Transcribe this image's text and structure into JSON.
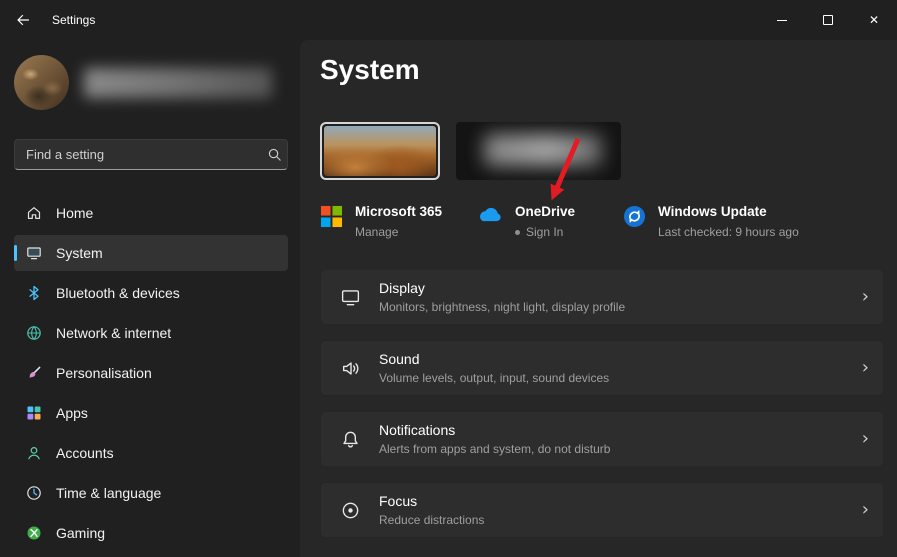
{
  "titlebar": {
    "title": "Settings",
    "controls": {
      "close": "✕"
    }
  },
  "sidebar": {
    "search": {
      "placeholder": "Find a setting"
    },
    "items": [
      {
        "label": "Home",
        "icon": "home-icon"
      },
      {
        "label": "System",
        "icon": "system-icon",
        "selected": true
      },
      {
        "label": "Bluetooth & devices",
        "icon": "bluetooth-icon"
      },
      {
        "label": "Network & internet",
        "icon": "network-icon"
      },
      {
        "label": "Personalisation",
        "icon": "personalisation-icon"
      },
      {
        "label": "Apps",
        "icon": "apps-icon"
      },
      {
        "label": "Accounts",
        "icon": "accounts-icon"
      },
      {
        "label": "Time & language",
        "icon": "time-language-icon"
      },
      {
        "label": "Gaming",
        "icon": "gaming-icon"
      }
    ]
  },
  "main": {
    "title": "System",
    "quick_cards": [
      {
        "title": "Microsoft 365",
        "subtitle": "Manage",
        "icon": "microsoft-365-icon"
      },
      {
        "title": "OneDrive",
        "subtitle": "Sign In",
        "icon": "onedrive-icon",
        "has_status_dot": true
      },
      {
        "title": "Windows Update",
        "subtitle": "Last checked: 9 hours ago",
        "icon": "windows-update-icon"
      }
    ],
    "rows": [
      {
        "title": "Display",
        "subtitle": "Monitors, brightness, night light, display profile",
        "icon": "display-icon"
      },
      {
        "title": "Sound",
        "subtitle": "Volume levels, output, input, sound devices",
        "icon": "sound-icon"
      },
      {
        "title": "Notifications",
        "subtitle": "Alerts from apps and system, do not disturb",
        "icon": "notifications-icon"
      },
      {
        "title": "Focus",
        "subtitle": "Reduce distractions",
        "icon": "focus-icon"
      }
    ],
    "chevron": "›"
  },
  "annotation": {
    "type": "red-arrow",
    "points_to": "OneDrive",
    "color": "#e31b23"
  },
  "colors": {
    "accent": "#4cc2ff",
    "arrow": "#e31b23",
    "background": "#202020",
    "card": "#2d2d2d"
  }
}
